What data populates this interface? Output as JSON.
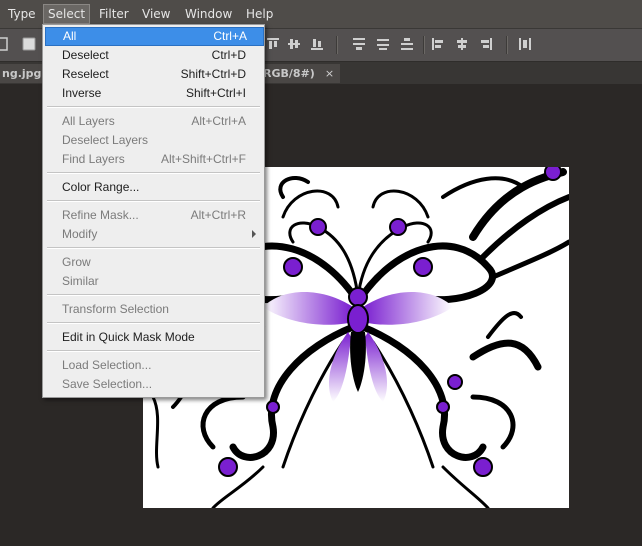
{
  "menubar": {
    "items": [
      "Type",
      "Select",
      "Filter",
      "View",
      "Window",
      "Help"
    ],
    "active": "Select"
  },
  "tabs": {
    "doc_left": "ng.jpg @",
    "doc_right": "(RGB/8#)",
    "close_glyph": "×"
  },
  "select_menu": {
    "items": [
      {
        "label": "All",
        "shortcut": "Ctrl+A"
      },
      {
        "label": "Deselect",
        "shortcut": "Ctrl+D"
      },
      {
        "label": "Reselect",
        "shortcut": "Shift+Ctrl+D"
      },
      {
        "label": "Inverse",
        "shortcut": "Shift+Ctrl+I"
      },
      {
        "label": "All Layers",
        "shortcut": "Alt+Ctrl+A"
      },
      {
        "label": "Deselect Layers",
        "shortcut": ""
      },
      {
        "label": "Find Layers",
        "shortcut": "Alt+Shift+Ctrl+F"
      },
      {
        "label": "Color Range...",
        "shortcut": ""
      },
      {
        "label": "Refine Mask...",
        "shortcut": "Alt+Ctrl+R"
      },
      {
        "label": "Modify",
        "shortcut": ""
      },
      {
        "label": "Grow",
        "shortcut": ""
      },
      {
        "label": "Similar",
        "shortcut": ""
      },
      {
        "label": "Transform Selection",
        "shortcut": ""
      },
      {
        "label": "Edit in Quick Mask Mode",
        "shortcut": ""
      },
      {
        "label": "Load Selection...",
        "shortcut": ""
      },
      {
        "label": "Save Selection...",
        "shortcut": ""
      }
    ]
  },
  "colors": {
    "highlight": "#3d8ee8",
    "butterfly_purple": "#7a1fd0",
    "app_background": "#2b2826"
  }
}
